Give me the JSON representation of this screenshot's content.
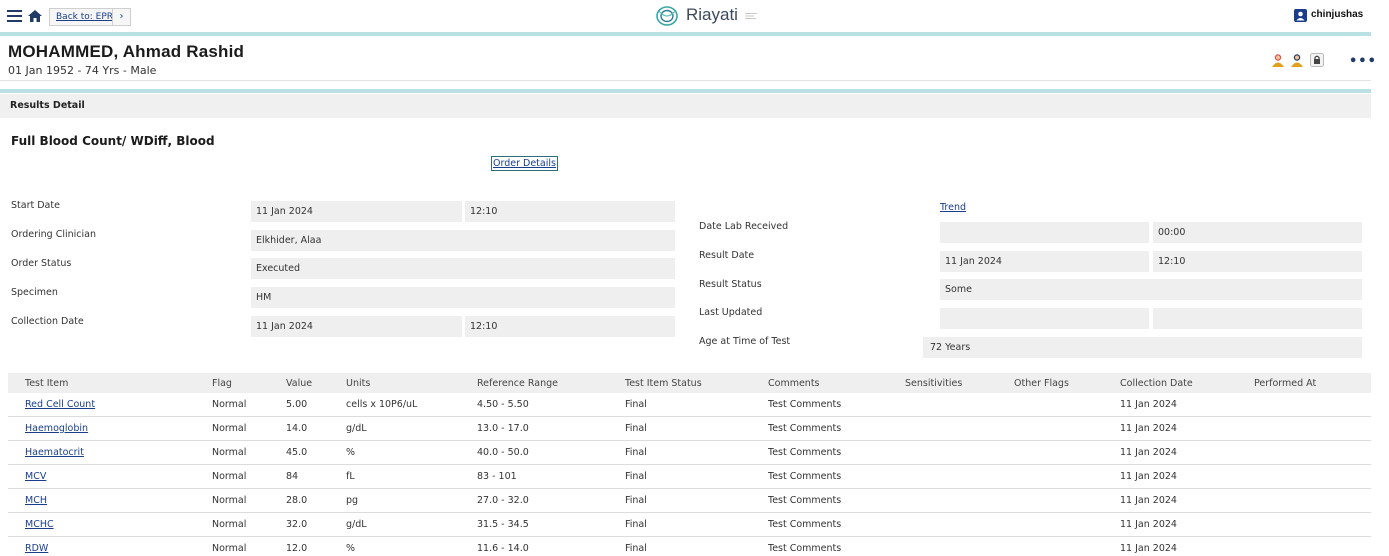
{
  "topbar": {
    "back_label": "Back to: EPR",
    "forward_glyph": "›",
    "brand": "Riayati",
    "user": "chinjushas"
  },
  "patient": {
    "name": "MOHAMMED, Ahmad Rashid",
    "details": "01 Jan 1952 - 74 Yrs - Male",
    "more_glyph": "•••"
  },
  "section": {
    "title": "Results Detail",
    "test_name": "Full Blood Count/ WDiff, Blood",
    "order_details_link": "Order Details",
    "trend_link": "Trend"
  },
  "details_left": [
    {
      "label": "Start Date",
      "value": "11 Jan 2024",
      "time": "12:10"
    },
    {
      "label": "Ordering Clinician",
      "value": "Elkhider, Alaa"
    },
    {
      "label": "Order Status",
      "value": "Executed"
    },
    {
      "label": "Specimen",
      "value": "HM"
    },
    {
      "label": "Collection Date",
      "value": "11 Jan 2024",
      "time": "12:10"
    }
  ],
  "details_right": [
    {
      "label": "Date Lab Received",
      "value": "",
      "time": "00:00"
    },
    {
      "label": "Result Date",
      "value": "11 Jan 2024",
      "time": "12:10"
    },
    {
      "label": "Result Status",
      "value": "Some"
    },
    {
      "label": "Last Updated",
      "value": "",
      "time": ""
    },
    {
      "label": "Age at Time of Test",
      "value": "72 Years"
    }
  ],
  "table": {
    "headers": [
      "Test Item",
      "Flag",
      "Value",
      "Units",
      "Reference Range",
      "Test Item Status",
      "Comments",
      "Sensitivities",
      "Other Flags",
      "Collection Date",
      "Performed At"
    ],
    "rows": [
      [
        "Red Cell Count",
        "Normal",
        "5.00",
        "cells x 10P6/uL",
        "4.50 - 5.50",
        "Final",
        "Test Comments",
        "",
        "",
        "11 Jan 2024",
        ""
      ],
      [
        "Haemoglobin",
        "Normal",
        "14.0",
        "g/dL",
        "13.0 - 17.0",
        "Final",
        "Test Comments",
        "",
        "",
        "11 Jan 2024",
        ""
      ],
      [
        "Haematocrit",
        "Normal",
        "45.0",
        "%",
        "40.0 - 50.0",
        "Final",
        "Test Comments",
        "",
        "",
        "11 Jan 2024",
        ""
      ],
      [
        "MCV",
        "Normal",
        "84",
        "fL",
        "83 - 101",
        "Final",
        "Test Comments",
        "",
        "",
        "11 Jan 2024",
        ""
      ],
      [
        "MCH",
        "Normal",
        "28.0",
        "pg",
        "27.0 - 32.0",
        "Final",
        "Test Comments",
        "",
        "",
        "11 Jan 2024",
        ""
      ],
      [
        "MCHC",
        "Normal",
        "32.0",
        "g/dL",
        "31.5 - 34.5",
        "Final",
        "Test Comments",
        "",
        "",
        "11 Jan 2024",
        ""
      ],
      [
        "RDW",
        "Normal",
        "12.0",
        "%",
        "11.6 - 14.0",
        "Final",
        "Test Comments",
        "",
        "",
        "11 Jan 2024",
        ""
      ]
    ]
  },
  "colors": {
    "accent": "#1a3e8c",
    "teal_band": "#b9e0e2",
    "field_bg": "#efefef"
  },
  "icons": {
    "menu": "hamburger-icon",
    "home": "home-icon",
    "brand": "riayati-logo-icon",
    "user": "user-icon",
    "clinician1": "clinician-icon",
    "clinician2": "clinician-alt-icon",
    "lock": "lock-icon"
  }
}
